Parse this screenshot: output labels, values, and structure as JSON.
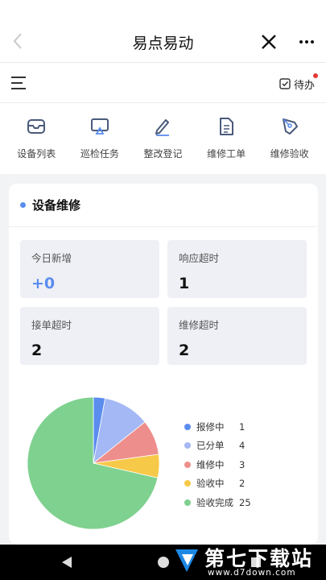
{
  "header": {
    "title": "易点易动"
  },
  "toolbar": {
    "todo_label": "待办"
  },
  "quick_actions": [
    {
      "label": "设备列表",
      "icon": "inbox-tray-icon"
    },
    {
      "label": "巡检任务",
      "icon": "monitor-icon"
    },
    {
      "label": "整改登记",
      "icon": "pen-icon"
    },
    {
      "label": "维修工单",
      "icon": "document-icon"
    },
    {
      "label": "维修验收",
      "icon": "quill-pen-icon"
    }
  ],
  "card": {
    "title": "设备维修",
    "stats": [
      {
        "label": "今日新增",
        "value": "+0"
      },
      {
        "label": "响应超时",
        "value": "1"
      },
      {
        "label": "接单超时",
        "value": "2"
      },
      {
        "label": "维修超时",
        "value": "2"
      }
    ]
  },
  "colors": {
    "accent": "#5b8def",
    "badge": "#e53935"
  },
  "chart_data": {
    "type": "pie",
    "legend_position": "right",
    "slices": [
      {
        "name": "报修中",
        "value": 1,
        "color": "#5b8def"
      },
      {
        "name": "已分单",
        "value": 4,
        "color": "#a3b8f4"
      },
      {
        "name": "维修中",
        "value": 3,
        "color": "#ee8e8c"
      },
      {
        "name": "验收中",
        "value": 2,
        "color": "#f7c948"
      },
      {
        "name": "验收完成",
        "value": 25,
        "color": "#7fd18f"
      }
    ]
  },
  "watermark": {
    "title": "第七下载站",
    "site": "www.d7down.com"
  }
}
